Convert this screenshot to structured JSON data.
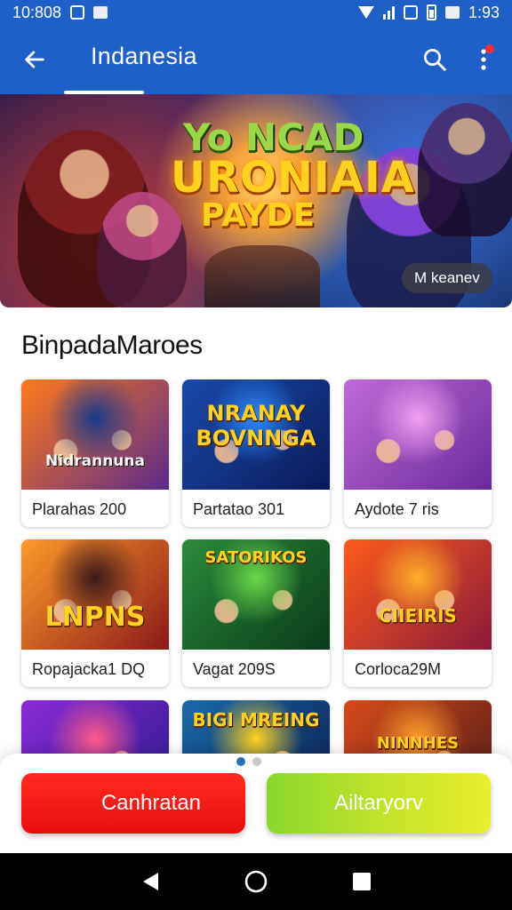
{
  "status_bar": {
    "time": "10:808",
    "clock_right": "1:93",
    "icons": [
      "notification-icon",
      "screenshot-icon",
      "wifi-icon",
      "signal-icon",
      "data-icon",
      "battery-icon"
    ]
  },
  "app_bar": {
    "title": "Indanesia",
    "back_icon": "arrow-left-icon",
    "search_icon": "search-icon",
    "menu_icon": "more-vertical-icon",
    "notification_color": "#ff2a2a",
    "background": "#1f5fc8"
  },
  "hero": {
    "title_line_1": "Yo NCAD",
    "title_line_2": "URONIAIA",
    "title_line_3": "PAYDE",
    "tag": "M keanev"
  },
  "section": {
    "title": "BinpadaMaroes"
  },
  "games": [
    {
      "caption": "Plarahas 200",
      "art_text": "Nidrannuna",
      "art_colors": [
        "#ff7a1a",
        "#5a2a8a",
        "#1a3a8a"
      ]
    },
    {
      "caption": "Partatao 301",
      "art_text": "NRANAY BOVNNGA",
      "art_colors": [
        "#1a4aaa",
        "#0a1a5a",
        "#2a8aff"
      ]
    },
    {
      "caption": "Aydote 7 ris",
      "art_text": "",
      "art_colors": [
        "#c06ad8",
        "#6a2a9a",
        "#f0a0f0"
      ]
    },
    {
      "caption": "Ropajacka1 DQ",
      "art_text": "LNPNS",
      "art_colors": [
        "#ff9a2a",
        "#8a1a1a",
        "#3a1a1a"
      ]
    },
    {
      "caption": "Vagat 209S",
      "art_text": "SATORIKOS",
      "art_colors": [
        "#2a8a3a",
        "#0a3a1a",
        "#6ad84a"
      ]
    },
    {
      "caption": "Corloca29M",
      "art_text": "CIIEIRIS",
      "art_colors": [
        "#ff5a1a",
        "#8a1a3a",
        "#ffb02a"
      ]
    },
    {
      "caption": "",
      "art_text": "",
      "art_colors": [
        "#8a2ad8",
        "#2a1a8a",
        "#ff5a8a"
      ]
    },
    {
      "caption": "",
      "art_text": "BIGI MREING",
      "art_colors": [
        "#1a6aaa",
        "#0a1a4a",
        "#ffd21f"
      ]
    },
    {
      "caption": "",
      "art_text": "NINNHES",
      "art_colors": [
        "#d84a1a",
        "#4a1a1a",
        "#ffa02a"
      ]
    }
  ],
  "pager": {
    "active_index": 0,
    "count": 2
  },
  "actions": {
    "primary_label": "Canhratan",
    "secondary_label": "Ailtaryorv",
    "primary_color": "#f01a14",
    "secondary_color": "#b8e02a"
  },
  "nav_bar": {
    "icons": [
      "back-triangle-icon",
      "home-circle-icon",
      "recents-square-icon"
    ]
  }
}
